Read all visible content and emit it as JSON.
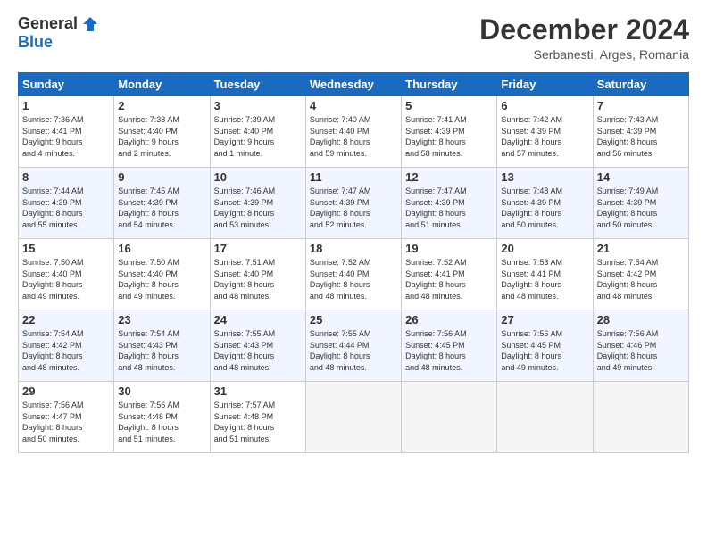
{
  "header": {
    "logo_general": "General",
    "logo_blue": "Blue",
    "title": "December 2024",
    "location": "Serbanesti, Arges, Romania"
  },
  "days_of_week": [
    "Sunday",
    "Monday",
    "Tuesday",
    "Wednesday",
    "Thursday",
    "Friday",
    "Saturday"
  ],
  "weeks": [
    [
      {
        "day": "1",
        "info": "Sunrise: 7:36 AM\nSunset: 4:41 PM\nDaylight: 9 hours\nand 4 minutes."
      },
      {
        "day": "2",
        "info": "Sunrise: 7:38 AM\nSunset: 4:40 PM\nDaylight: 9 hours\nand 2 minutes."
      },
      {
        "day": "3",
        "info": "Sunrise: 7:39 AM\nSunset: 4:40 PM\nDaylight: 9 hours\nand 1 minute."
      },
      {
        "day": "4",
        "info": "Sunrise: 7:40 AM\nSunset: 4:40 PM\nDaylight: 8 hours\nand 59 minutes."
      },
      {
        "day": "5",
        "info": "Sunrise: 7:41 AM\nSunset: 4:39 PM\nDaylight: 8 hours\nand 58 minutes."
      },
      {
        "day": "6",
        "info": "Sunrise: 7:42 AM\nSunset: 4:39 PM\nDaylight: 8 hours\nand 57 minutes."
      },
      {
        "day": "7",
        "info": "Sunrise: 7:43 AM\nSunset: 4:39 PM\nDaylight: 8 hours\nand 56 minutes."
      }
    ],
    [
      {
        "day": "8",
        "info": "Sunrise: 7:44 AM\nSunset: 4:39 PM\nDaylight: 8 hours\nand 55 minutes."
      },
      {
        "day": "9",
        "info": "Sunrise: 7:45 AM\nSunset: 4:39 PM\nDaylight: 8 hours\nand 54 minutes."
      },
      {
        "day": "10",
        "info": "Sunrise: 7:46 AM\nSunset: 4:39 PM\nDaylight: 8 hours\nand 53 minutes."
      },
      {
        "day": "11",
        "info": "Sunrise: 7:47 AM\nSunset: 4:39 PM\nDaylight: 8 hours\nand 52 minutes."
      },
      {
        "day": "12",
        "info": "Sunrise: 7:47 AM\nSunset: 4:39 PM\nDaylight: 8 hours\nand 51 minutes."
      },
      {
        "day": "13",
        "info": "Sunrise: 7:48 AM\nSunset: 4:39 PM\nDaylight: 8 hours\nand 50 minutes."
      },
      {
        "day": "14",
        "info": "Sunrise: 7:49 AM\nSunset: 4:39 PM\nDaylight: 8 hours\nand 50 minutes."
      }
    ],
    [
      {
        "day": "15",
        "info": "Sunrise: 7:50 AM\nSunset: 4:40 PM\nDaylight: 8 hours\nand 49 minutes."
      },
      {
        "day": "16",
        "info": "Sunrise: 7:50 AM\nSunset: 4:40 PM\nDaylight: 8 hours\nand 49 minutes."
      },
      {
        "day": "17",
        "info": "Sunrise: 7:51 AM\nSunset: 4:40 PM\nDaylight: 8 hours\nand 48 minutes."
      },
      {
        "day": "18",
        "info": "Sunrise: 7:52 AM\nSunset: 4:40 PM\nDaylight: 8 hours\nand 48 minutes."
      },
      {
        "day": "19",
        "info": "Sunrise: 7:52 AM\nSunset: 4:41 PM\nDaylight: 8 hours\nand 48 minutes."
      },
      {
        "day": "20",
        "info": "Sunrise: 7:53 AM\nSunset: 4:41 PM\nDaylight: 8 hours\nand 48 minutes."
      },
      {
        "day": "21",
        "info": "Sunrise: 7:54 AM\nSunset: 4:42 PM\nDaylight: 8 hours\nand 48 minutes."
      }
    ],
    [
      {
        "day": "22",
        "info": "Sunrise: 7:54 AM\nSunset: 4:42 PM\nDaylight: 8 hours\nand 48 minutes."
      },
      {
        "day": "23",
        "info": "Sunrise: 7:54 AM\nSunset: 4:43 PM\nDaylight: 8 hours\nand 48 minutes."
      },
      {
        "day": "24",
        "info": "Sunrise: 7:55 AM\nSunset: 4:43 PM\nDaylight: 8 hours\nand 48 minutes."
      },
      {
        "day": "25",
        "info": "Sunrise: 7:55 AM\nSunset: 4:44 PM\nDaylight: 8 hours\nand 48 minutes."
      },
      {
        "day": "26",
        "info": "Sunrise: 7:56 AM\nSunset: 4:45 PM\nDaylight: 8 hours\nand 48 minutes."
      },
      {
        "day": "27",
        "info": "Sunrise: 7:56 AM\nSunset: 4:45 PM\nDaylight: 8 hours\nand 49 minutes."
      },
      {
        "day": "28",
        "info": "Sunrise: 7:56 AM\nSunset: 4:46 PM\nDaylight: 8 hours\nand 49 minutes."
      }
    ],
    [
      {
        "day": "29",
        "info": "Sunrise: 7:56 AM\nSunset: 4:47 PM\nDaylight: 8 hours\nand 50 minutes."
      },
      {
        "day": "30",
        "info": "Sunrise: 7:56 AM\nSunset: 4:48 PM\nDaylight: 8 hours\nand 51 minutes."
      },
      {
        "day": "31",
        "info": "Sunrise: 7:57 AM\nSunset: 4:48 PM\nDaylight: 8 hours\nand 51 minutes."
      },
      {
        "day": "",
        "info": ""
      },
      {
        "day": "",
        "info": ""
      },
      {
        "day": "",
        "info": ""
      },
      {
        "day": "",
        "info": ""
      }
    ]
  ]
}
